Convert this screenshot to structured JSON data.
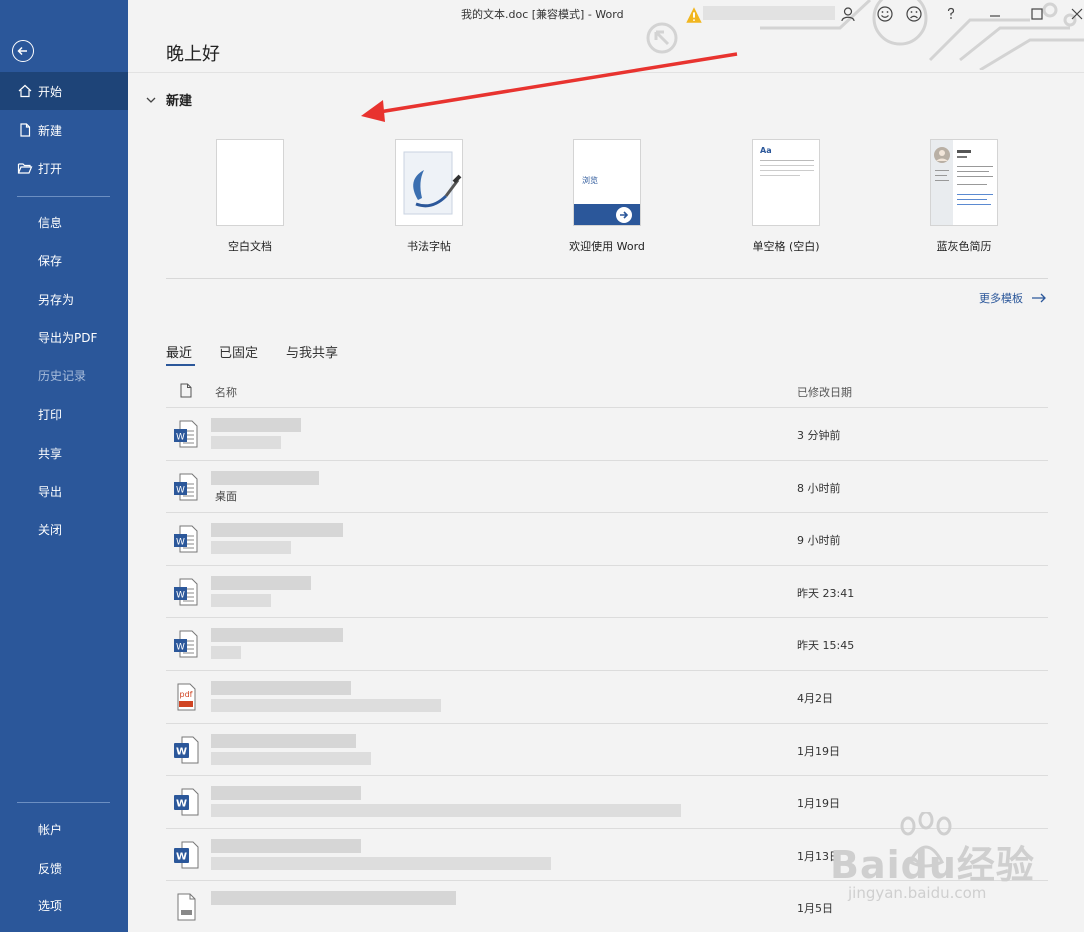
{
  "window": {
    "title": "我的文本.doc [兼容模式] - Word"
  },
  "sidebar": {
    "items": [
      {
        "label": "开始",
        "icon": "home-icon"
      },
      {
        "label": "新建",
        "icon": "new-doc-icon"
      },
      {
        "label": "打开",
        "icon": "folder-open-icon"
      },
      {
        "label": "信息"
      },
      {
        "label": "保存"
      },
      {
        "label": "另存为"
      },
      {
        "label": "导出为PDF"
      },
      {
        "label": "历史记录"
      },
      {
        "label": "打印"
      },
      {
        "label": "共享"
      },
      {
        "label": "导出"
      },
      {
        "label": "关闭"
      },
      {
        "label": "帐户"
      },
      {
        "label": "反馈"
      },
      {
        "label": "选项"
      }
    ]
  },
  "main": {
    "greeting": "晚上好",
    "new_section": "新建",
    "templates": [
      {
        "label": "空白文档"
      },
      {
        "label": "书法字帖"
      },
      {
        "label": "欢迎使用 Word",
        "thumb_text": "浏览"
      },
      {
        "label": "单空格 (空白)",
        "thumb_text": "Aa"
      },
      {
        "label": "蓝灰色简历"
      }
    ],
    "more_templates": "更多模板",
    "tabs": [
      "最近",
      "已固定",
      "与我共享"
    ],
    "columns": {
      "name": "名称",
      "modified": "已修改日期"
    },
    "files": [
      {
        "type": "doc",
        "path": "",
        "date": "3 分钟前"
      },
      {
        "type": "doc",
        "path": "桌面",
        "date": "8 小时前"
      },
      {
        "type": "doc",
        "path": "",
        "date": "9 小时前"
      },
      {
        "type": "doc",
        "path": "",
        "date": "昨天 23:41"
      },
      {
        "type": "doc",
        "path": "",
        "date": "昨天 15:45"
      },
      {
        "type": "pdf",
        "path": "",
        "date": "4月2日"
      },
      {
        "type": "docx",
        "path": "",
        "date": "1月19日"
      },
      {
        "type": "docx",
        "path": "",
        "date": "1月19日"
      },
      {
        "type": "docx",
        "path": "",
        "date": "1月13日"
      },
      {
        "type": "generic",
        "path": "",
        "date": "1月5日"
      }
    ]
  },
  "watermark": {
    "brand": "Baidu经验",
    "url": "jingyan.baidu.com"
  },
  "colors": {
    "accent": "#2b579a",
    "annotation": "#e8332f",
    "pdf": "#d04423"
  }
}
